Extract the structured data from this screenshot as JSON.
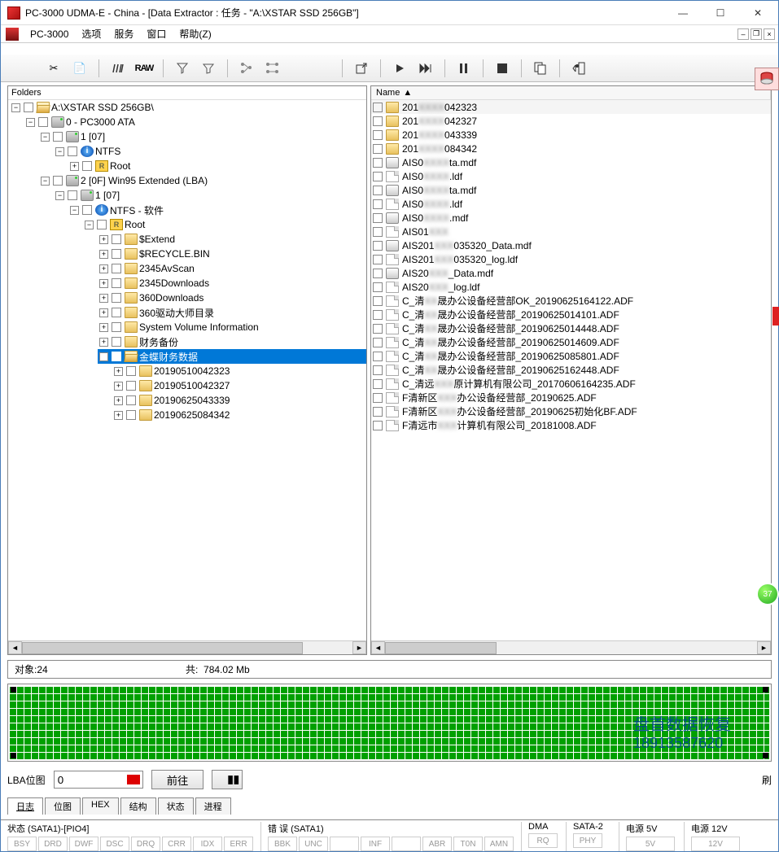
{
  "window": {
    "title": "PC-3000 UDMA-E - China - [Data Extractor : 任务 - \"A:\\XSTAR SSD 256GB\"]"
  },
  "menubar": {
    "app": "PC-3000",
    "items": [
      "选项",
      "服务",
      "窗口",
      "帮助(Z)"
    ]
  },
  "folders_header": "Folders",
  "filelist_header": "Name",
  "tree": {
    "root": "A:\\XSTAR SSD 256GB\\",
    "ata": "0 - PC3000 ATA",
    "p1": "1 [07]",
    "ntfs1": "NTFS",
    "root1": "Root",
    "p2": "2 [0F] Win95 Extended  (LBA)",
    "p2_1": "1 [07]",
    "ntfs2": "NTFS - 软件",
    "root2": "Root",
    "items": [
      "$Extend",
      "$RECYCLE.BIN",
      "2345AvScan",
      "2345Downloads",
      "360Downloads",
      "360驱动大师目录",
      "System Volume Information",
      "财务备份",
      "金蝶财务数据"
    ],
    "sub": [
      "20190510042323",
      "20190510042327",
      "20190625043339",
      "20190625084342"
    ]
  },
  "files": [
    {
      "t": "folder",
      "pre": "201",
      "blur": "XXXX",
      "post": "042323",
      "sel": true
    },
    {
      "t": "folder",
      "pre": "201",
      "blur": "XXXX",
      "post": "042327"
    },
    {
      "t": "folder",
      "pre": "201",
      "blur": "XXXX",
      "post": "043339"
    },
    {
      "t": "folder",
      "pre": "201",
      "blur": "XXXX",
      "post": "084342"
    },
    {
      "t": "db",
      "pre": "AIS0",
      "blur": "XXXX",
      "post": "ta.mdf"
    },
    {
      "t": "file",
      "pre": "AIS0",
      "blur": "XXXX",
      "post": ".ldf"
    },
    {
      "t": "db",
      "pre": "AIS0",
      "blur": "XXXX",
      "post": "ta.mdf"
    },
    {
      "t": "file",
      "pre": "AIS0",
      "blur": "XXXX",
      "post": ".ldf"
    },
    {
      "t": "db",
      "pre": "AIS0",
      "blur": "XXXX",
      "post": ".mdf"
    },
    {
      "t": "file",
      "pre": "AIS01",
      "blur": "XXX",
      "post": ""
    },
    {
      "t": "db",
      "pre": "AIS201",
      "blur": "XXX",
      "post": "035320_Data.mdf"
    },
    {
      "t": "file",
      "pre": "AIS201",
      "blur": "XXX",
      "post": "035320_log.ldf"
    },
    {
      "t": "db",
      "pre": "AIS20",
      "blur": "XXX",
      "post": "_Data.mdf"
    },
    {
      "t": "file",
      "pre": "AIS20",
      "blur": "XXX",
      "post": "_log.ldf"
    },
    {
      "t": "file",
      "pre": "C_清",
      "blur": "XX",
      "post": "晟办公设备经营部OK_20190625164122.ADF"
    },
    {
      "t": "file",
      "pre": "C_清",
      "blur": "XX",
      "post": "晟办公设备经营部_20190625014101.ADF"
    },
    {
      "t": "file",
      "pre": "C_清",
      "blur": "XX",
      "post": "晟办公设备经营部_20190625014448.ADF"
    },
    {
      "t": "file",
      "pre": "C_清",
      "blur": "XX",
      "post": "晟办公设备经营部_20190625014609.ADF"
    },
    {
      "t": "file",
      "pre": "C_清",
      "blur": "XX",
      "post": "晟办公设备经营部_20190625085801.ADF"
    },
    {
      "t": "file",
      "pre": "C_清",
      "blur": "XX",
      "post": "晟办公设备经营部_20190625162448.ADF"
    },
    {
      "t": "file",
      "pre": "C_清远",
      "blur": "XXX",
      "post": "原计算机有限公司_20170606164235.ADF"
    },
    {
      "t": "file",
      "pre": "F清新区",
      "blur": "XXX",
      "post": "办公设备经营部_20190625.ADF"
    },
    {
      "t": "file",
      "pre": "F清新区",
      "blur": "XXX",
      "post": "办公设备经营部_20190625初始化BF.ADF"
    },
    {
      "t": "file",
      "pre": "F清远市",
      "blur": "XXX",
      "post": "计算机有限公司_20181008.ADF"
    }
  ],
  "summary": {
    "objects_label": "对象:",
    "objects": "24",
    "total_label": "共:",
    "total": "784.02 Mb"
  },
  "lba": {
    "label": "LBA位图",
    "value": "0",
    "go": "前往",
    "refresh_suffix": "刷"
  },
  "tabs": [
    "日志",
    "位图",
    "HEX",
    "结构",
    "状态",
    "进程"
  ],
  "status": {
    "g1_label": "状态 (SATA1)-[PIO4]",
    "g1": [
      "BSY",
      "DRD",
      "DWF",
      "DSC",
      "DRQ",
      "CRR",
      "IDX",
      "ERR"
    ],
    "g2_label": "错 误 (SATA1)",
    "g2": [
      "BBK",
      "UNC",
      "",
      "INF",
      "",
      "ABR",
      "T0N",
      "AMN"
    ],
    "dma_label": "DMA",
    "dma": "RQ",
    "sata2_label": "SATA-2",
    "sata2": "PHY",
    "p5_label": "电源 5V",
    "p5": "5V",
    "p12_label": "电源 12V",
    "p12": "12V"
  },
  "watermark": {
    "l1": "盘首数据恢复",
    "l2": "18913587620"
  },
  "badge": "37"
}
